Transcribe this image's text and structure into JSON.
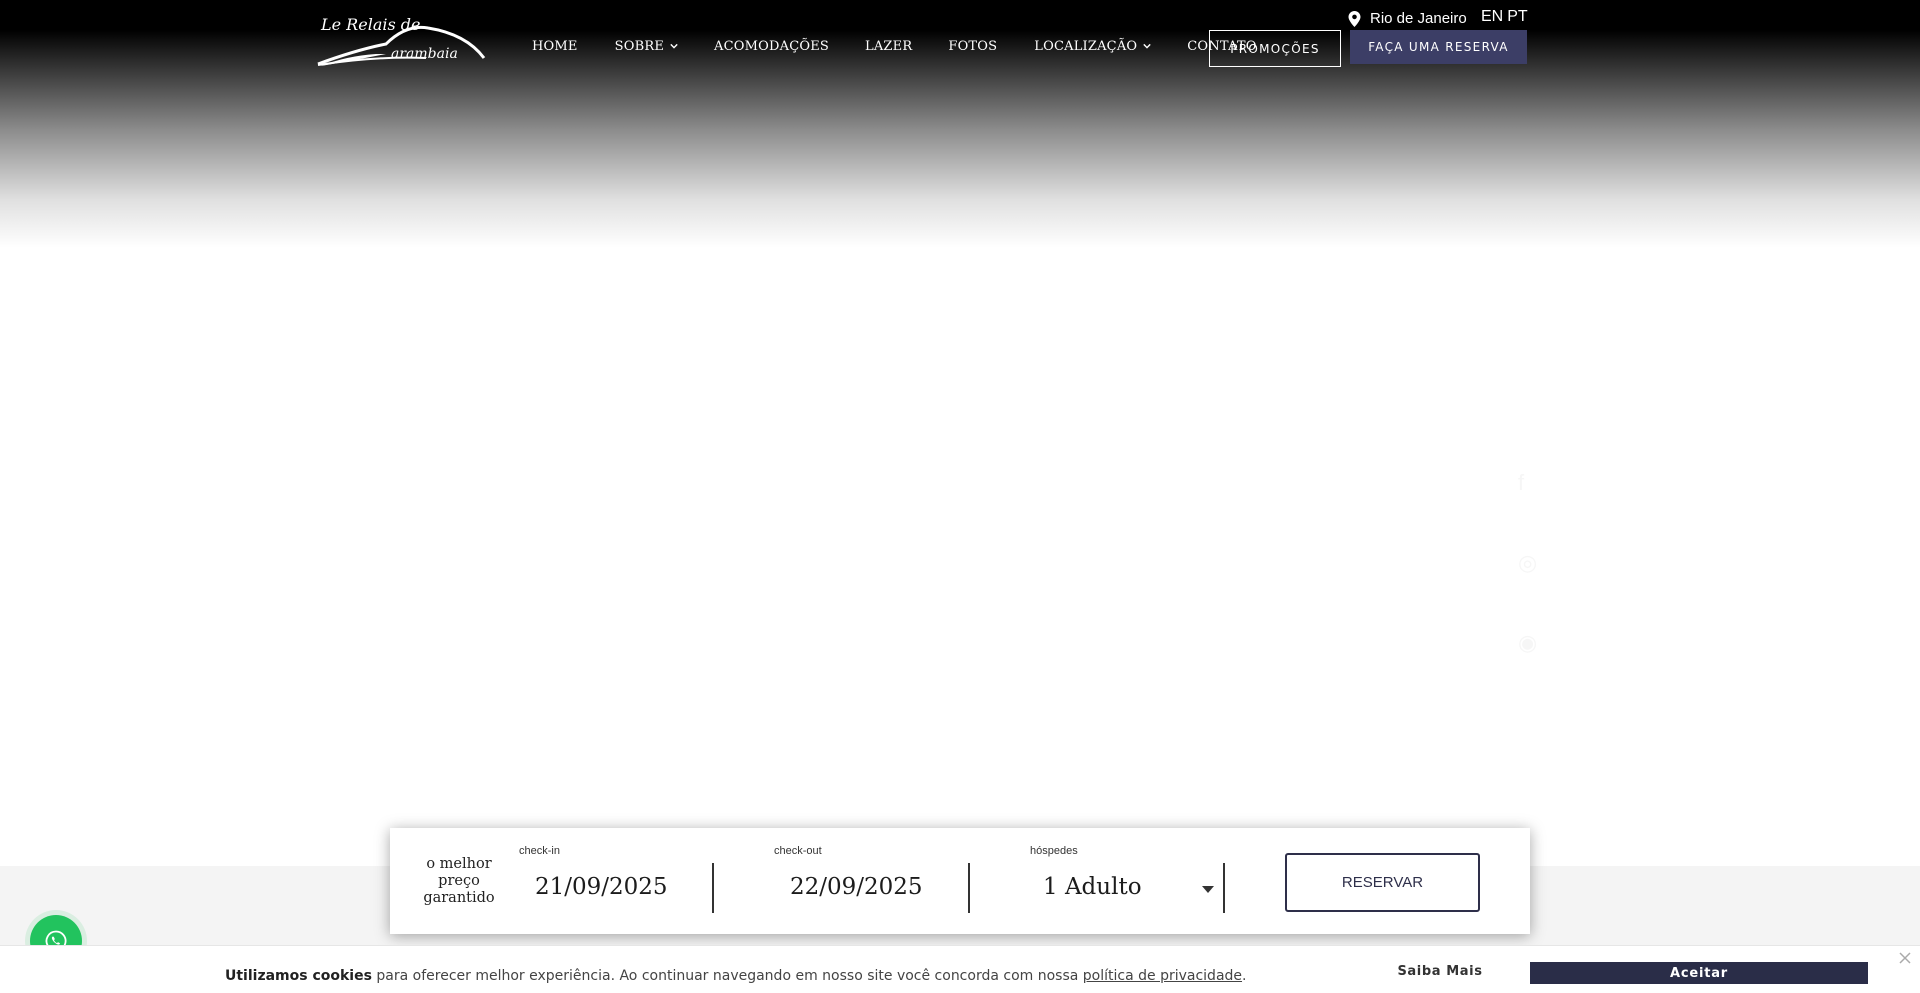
{
  "header": {
    "logo_alt": "Le Relais de Marambaia",
    "nav": [
      {
        "label": "HOME",
        "has_dropdown": false
      },
      {
        "label": "SOBRE",
        "has_dropdown": true
      },
      {
        "label": "ACOMODAÇÕES",
        "has_dropdown": false
      },
      {
        "label": "LAZER",
        "has_dropdown": false
      },
      {
        "label": "FOTOS",
        "has_dropdown": false
      },
      {
        "label": "LOCALIZAÇÃO",
        "has_dropdown": true
      },
      {
        "label": "CONTATO",
        "has_dropdown": false
      }
    ],
    "promo_label": "PROMOÇÕES",
    "reserve_label": "FAÇA UMA RESERVA",
    "location": "Rio de Janeiro",
    "lang_en": "EN",
    "lang_pt": "PT",
    "location_icon": "map-pin-icon"
  },
  "booking": {
    "best_price": "o melhor preço garantido",
    "checkin_label": "check-in",
    "checkin_value": "21/09/2025",
    "checkout_label": "check-out",
    "checkout_value": "22/09/2025",
    "guests_label": "hóspedes",
    "guests_value": "1 Adulto",
    "submit_label": "RESERVAR"
  },
  "cookie": {
    "bold": "Utilizamos cookies",
    "text": " para oferecer melhor experiência. Ao continuar navegando em nosso site você concorda com nossa ",
    "link": "política de privacidade",
    "end": ".",
    "learn_more": "Saiba Mais",
    "accept": "Aceitar"
  },
  "colors": {
    "accent": "#3c3e66",
    "dark_button": "#2a2d48",
    "whatsapp": "#22c35e"
  }
}
